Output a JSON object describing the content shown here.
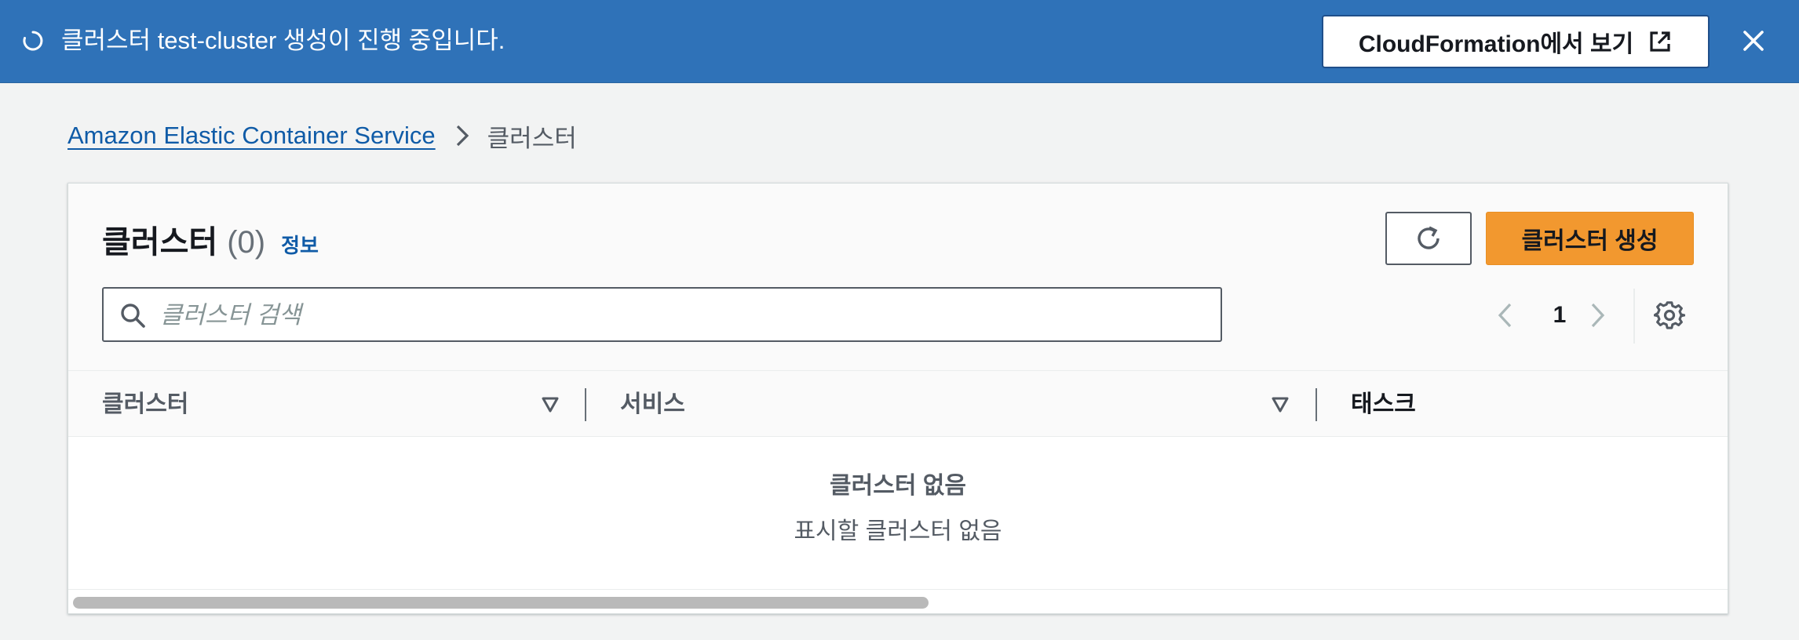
{
  "flash": {
    "message": "클러스터 test-cluster 생성이 진행 중입니다.",
    "action_label": "CloudFormation에서 보기",
    "background_color": "#2f72b8",
    "icons": {
      "spinner": "loading-spinner-icon",
      "external": "external-link-icon",
      "close": "close-icon"
    }
  },
  "breadcrumb": {
    "root": "Amazon Elastic Container Service",
    "current": "클러스터"
  },
  "panel": {
    "title": "클러스터",
    "count": "(0)",
    "info_link": "정보",
    "refresh_icon": "refresh-icon",
    "create_button": "클러스터 생성",
    "create_button_color": "#f2982f"
  },
  "search": {
    "placeholder": "클러스터 검색",
    "value": ""
  },
  "pagination": {
    "current_page": "1",
    "prev_icon": "chevron-left-icon",
    "next_icon": "chevron-right-icon",
    "settings_icon": "gear-icon"
  },
  "table": {
    "columns": [
      "클러스터",
      "서비스",
      "태스크"
    ],
    "rows": [],
    "empty_title": "클러스터 없음",
    "empty_description": "표시할 클러스터 없음"
  }
}
